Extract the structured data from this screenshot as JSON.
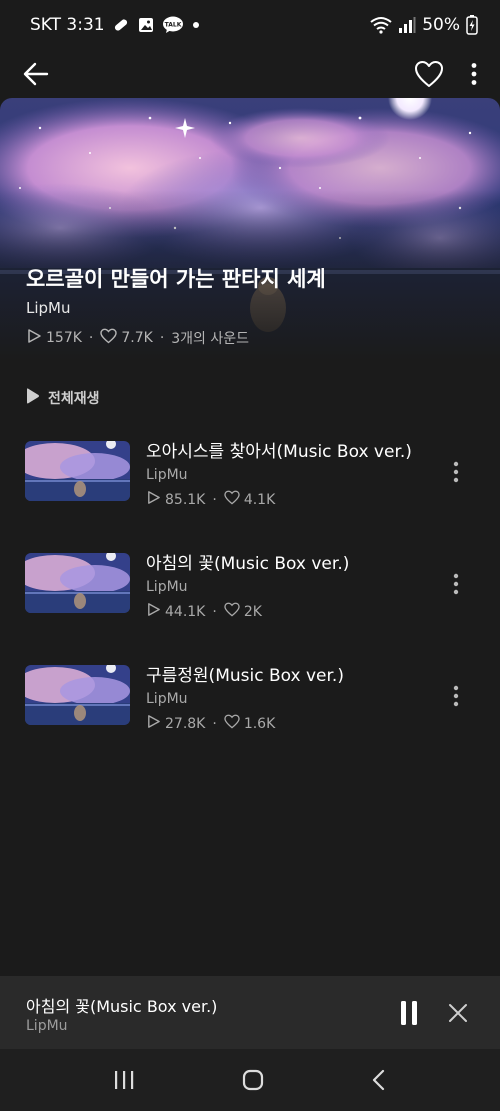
{
  "status_bar": {
    "carrier_time": "SKT 3:31",
    "notification_badge": "TALK",
    "battery": "50%"
  },
  "app_bar": {
    "back_icon": "arrow-left-icon",
    "like_icon": "heart-outline-icon",
    "more_icon": "kebab-icon"
  },
  "playlist": {
    "title": "오르골이 만들어 가는 판타지 세계",
    "artist": "LipMu",
    "plays": "157K",
    "likes": "7.7K",
    "sound_count": "3개의 사운드"
  },
  "play_all_label": "전체재생",
  "tracks": [
    {
      "title": "오아시스를 찾아서(Music Box ver.)",
      "artist": "LipMu",
      "plays": "85.1K",
      "likes": "4.1K"
    },
    {
      "title": "아침의 꽃(Music Box ver.)",
      "artist": "LipMu",
      "plays": "44.1K",
      "likes": "2K"
    },
    {
      "title": "구름정원(Music Box ver.)",
      "artist": "LipMu",
      "plays": "27.8K",
      "likes": "1.6K"
    }
  ],
  "mini_player": {
    "title": "아침의 꽃(Music Box ver.)",
    "artist": "LipMu"
  },
  "colors": {
    "background": "#1b1b1b",
    "mini_player_bg": "#2a2a2a",
    "secondary_text": "#a9a9a9"
  }
}
